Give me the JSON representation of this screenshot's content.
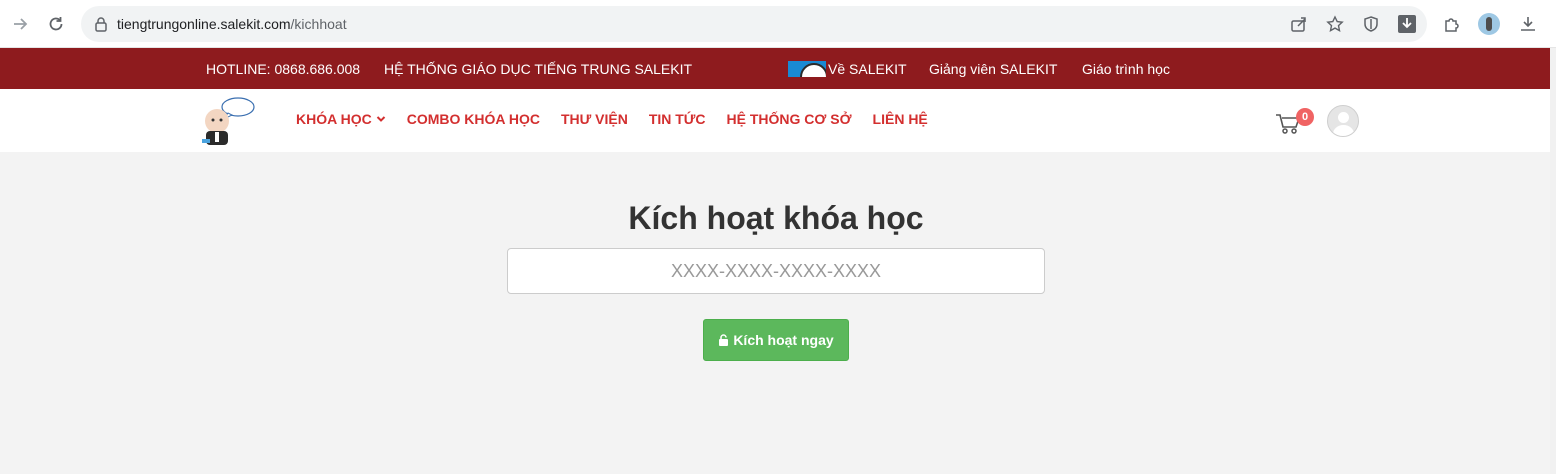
{
  "browser": {
    "url_host": "tiengtrungonline.salekit.com",
    "url_path": "/kichhoat"
  },
  "topbar": {
    "hotline": "HOTLINE: 0868.686.008",
    "system": "HỆ THỐNG GIÁO DỤC TIẾNG TRUNG SALEKIT",
    "about": "Về SALEKIT",
    "teachers": "Giảng viên SALEKIT",
    "curriculum": "Giáo trình học"
  },
  "nav": {
    "items": [
      {
        "label": "KHÓA HỌC"
      },
      {
        "label": "COMBO KHÓA HỌC"
      },
      {
        "label": "THƯ VIỆN"
      },
      {
        "label": "TIN TỨC"
      },
      {
        "label": "HỆ THỐNG CƠ SỞ"
      },
      {
        "label": "LIÊN HỆ"
      }
    ],
    "cart_count": "0"
  },
  "main": {
    "title": "Kích hoạt khóa học",
    "code_placeholder": "XXXX-XXXX-XXXX-XXXX",
    "activate_label": "Kích hoạt ngay"
  },
  "colors": {
    "topbar_bg": "#8e1b1e",
    "nav_text": "#d32f2f",
    "button_green": "#5cb85c",
    "badge_red": "#f06363"
  },
  "icons": [
    "back-arrow-icon",
    "reload-icon",
    "lock-icon",
    "share-icon",
    "star-icon",
    "shield-icon",
    "download-ext-icon",
    "puzzle-icon",
    "profile-icon",
    "download-icon",
    "chevron-down-icon",
    "cart-icon",
    "user-avatar-icon",
    "unlock-icon"
  ]
}
